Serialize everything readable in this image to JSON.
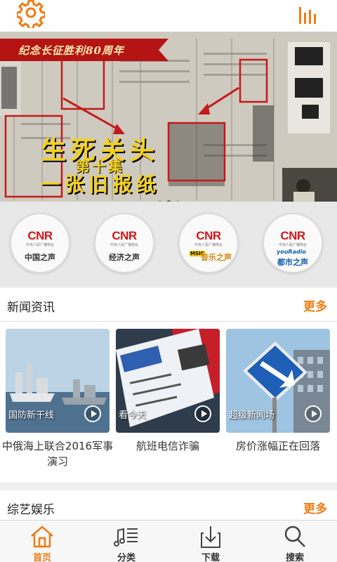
{
  "banner": {
    "ribbon_text": "纪念长征胜利80周年",
    "title": "生死关头",
    "episode": "第十集",
    "subtitle": "一张旧报纸",
    "slides": 3,
    "active_slide": 2
  },
  "channels": [
    {
      "logo": "CNR",
      "logo_sub": "中央人民广播电台",
      "name": "中国之声",
      "style": "plain"
    },
    {
      "logo": "CNR",
      "logo_sub": "中央人民广播电台",
      "name": "经济之声",
      "style": "plain"
    },
    {
      "logo": "CNR",
      "logo_sub": "中央人民广播电台",
      "name": "音乐之声",
      "style": "music",
      "tag": "MSIC"
    },
    {
      "logo": "CNR",
      "logo_sub": "中央人民广播电台",
      "name": "都市之声",
      "style": "you",
      "tag": "youRadio"
    }
  ],
  "news_section": {
    "title": "新闻资讯",
    "more": "更多",
    "cards": [
      {
        "tag": "国防新干线",
        "caption": "中俄海上联合2016军事演习"
      },
      {
        "tag": "看今天",
        "caption": "航班电信诈骗"
      },
      {
        "tag": "超级新闻场",
        "caption": "房价涨幅正在回落"
      }
    ]
  },
  "variety_section": {
    "title": "综艺娱乐",
    "more": "更多"
  },
  "bottom_nav": [
    {
      "label": "首页",
      "icon": "home-icon",
      "active": true
    },
    {
      "label": "分类",
      "icon": "music-list-icon",
      "active": false
    },
    {
      "label": "下载",
      "icon": "download-icon",
      "active": false
    },
    {
      "label": "搜索",
      "icon": "search-icon",
      "active": false
    }
  ],
  "colors": {
    "accent": "#f07b14",
    "banner_text": "#f3d020",
    "cnr_red": "#d01818"
  }
}
